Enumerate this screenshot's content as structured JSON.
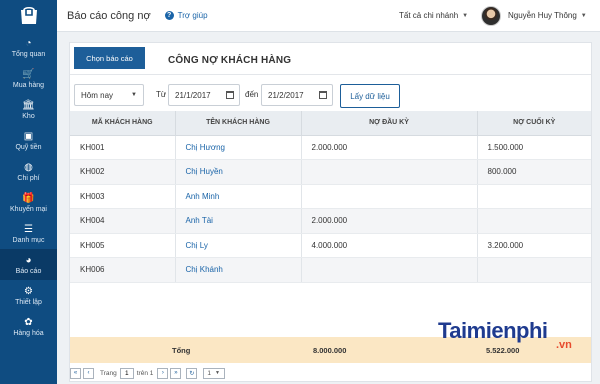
{
  "sidebar": {
    "logo_icon": "store-bag-icon",
    "items": [
      {
        "label": "Tổng quan",
        "icon": "dashboard-icon",
        "glyph": "◔"
      },
      {
        "label": "Mua hàng",
        "icon": "cart-icon",
        "glyph": "🛒"
      },
      {
        "label": "Kho",
        "icon": "warehouse-icon",
        "glyph": "🏛"
      },
      {
        "label": "Quỹ tiền",
        "icon": "money-icon",
        "glyph": "▣"
      },
      {
        "label": "Chi phí",
        "icon": "expense-icon",
        "glyph": "◍"
      },
      {
        "label": "Khuyến mại",
        "icon": "gift-icon",
        "glyph": "🎁"
      },
      {
        "label": "Danh mục",
        "icon": "list-icon",
        "glyph": "☰"
      },
      {
        "label": "Báo cáo",
        "icon": "report-pie-icon",
        "glyph": "◕"
      },
      {
        "label": "Thiết lập",
        "icon": "gear-icon",
        "glyph": "⚙"
      },
      {
        "label": "Hàng hóa",
        "icon": "goods-icon",
        "glyph": "✿"
      }
    ]
  },
  "topbar": {
    "title": "Báo cáo công nợ",
    "help": "Trợ giúp",
    "branch": "Tất cả chi nhánh",
    "user": "Nguyễn Huy Thông"
  },
  "panel": {
    "select_report_button": "Chọn báo cáo",
    "report_title": "CÔNG NỢ KHÁCH HÀNG",
    "period_select": "Hôm nay",
    "from_label": "Từ",
    "from_date": "21/1/2017",
    "to_label": "đến",
    "to_date": "21/2/2017",
    "fetch_button": "Lấy dữ liệu"
  },
  "table": {
    "headers": [
      "MÃ KHÁCH HÀNG",
      "TÊN KHÁCH HÀNG",
      "NỢ ĐẦU KỲ",
      "NỢ CUỐI KỲ"
    ],
    "rows": [
      [
        "KH001",
        "Chị Hương",
        "2.000.000",
        "1.500.000"
      ],
      [
        "KH002",
        "Chị Huyền",
        "",
        "800.000"
      ],
      [
        "KH003",
        "Anh Minh",
        "",
        ""
      ],
      [
        "KH004",
        "Anh Tài",
        "2.000.000",
        ""
      ],
      [
        "KH005",
        "Chị Ly",
        "4.000.000",
        "3.200.000"
      ],
      [
        "KH006",
        "Chị Khánh",
        "",
        ""
      ]
    ],
    "totals": {
      "label": "Tổng",
      "opening": "8.000.000",
      "closing": "5.522.000"
    }
  },
  "pager": {
    "page_label": "Trang",
    "page": "1",
    "of_label": "trên 1",
    "page_size": "1"
  },
  "watermark": {
    "text": "Taimienphi",
    "suffix": ".vn"
  }
}
